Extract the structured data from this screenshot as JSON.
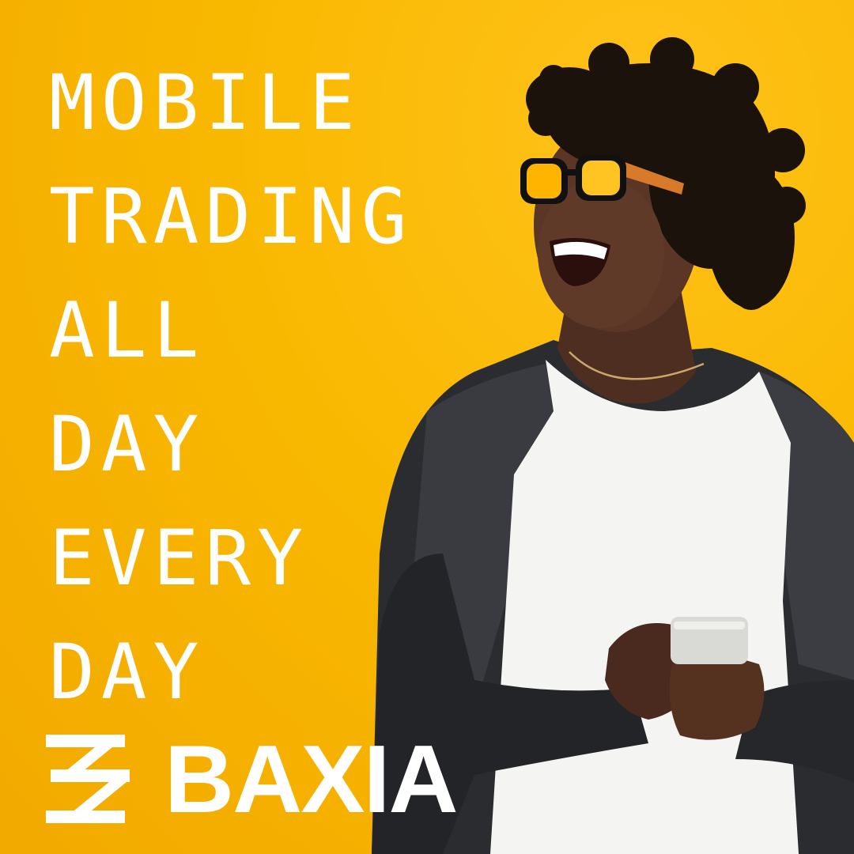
{
  "headline": {
    "lines": [
      "MOBILE",
      "TRADING",
      "ALL",
      "DAY",
      "EVERY",
      "DAY"
    ]
  },
  "brand": {
    "name": "BAXIA"
  },
  "colors": {
    "background": "#f9b800",
    "text": "#ffffff",
    "jacket": "#2a2b2e",
    "shirt": "#f4f4f2",
    "skin": "#5b3626",
    "hair": "#1b120c",
    "lens": "#ffb400",
    "frame": "#d77a2a"
  }
}
